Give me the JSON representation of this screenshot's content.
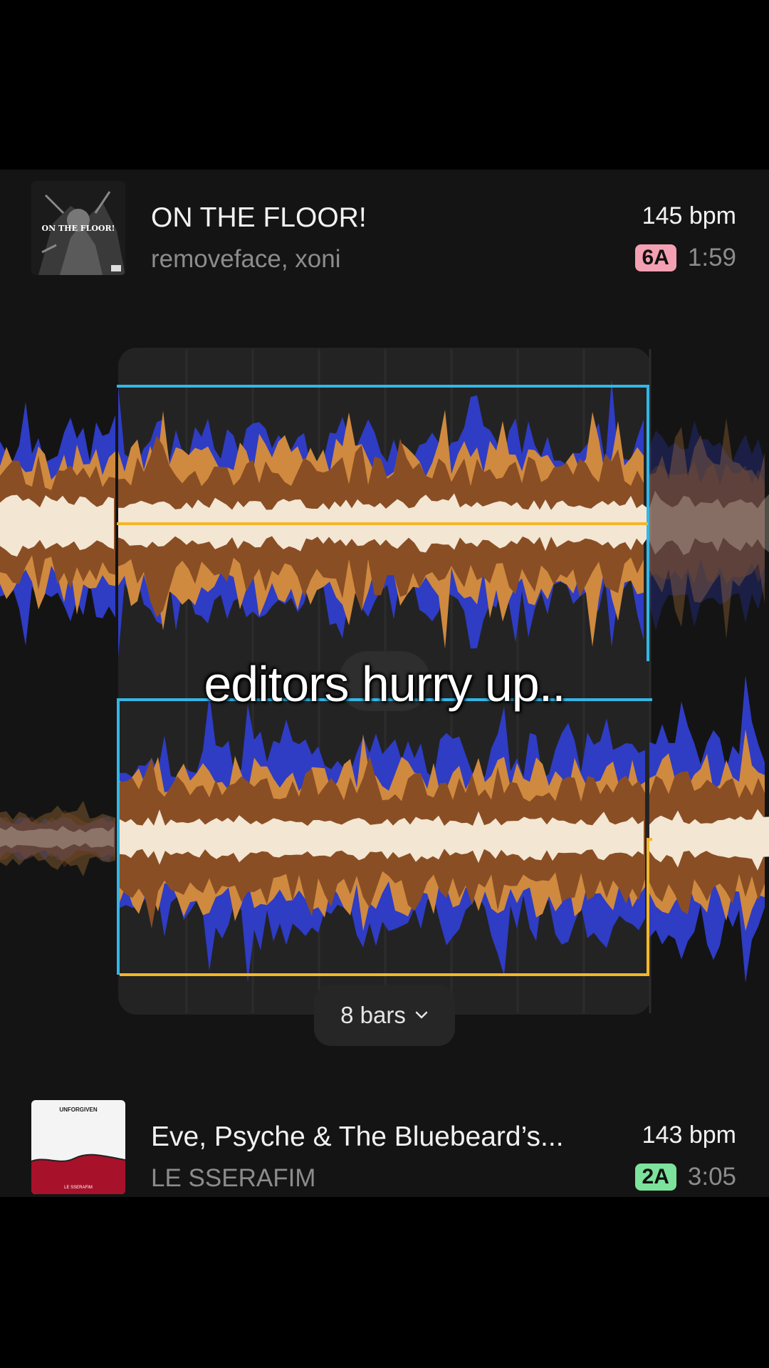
{
  "tracks": {
    "current": {
      "title": "ON THE FLOOR!",
      "artist": "removeface, xoni",
      "bpm": "145 bpm",
      "key": "6A",
      "key_color": "#f4a0b3",
      "duration": "1:59",
      "cover_text": "ON THE FLOOR!"
    },
    "next": {
      "title": "Eve, Psyche & The Bluebeard’s...",
      "artist": "LE SSERAFIM",
      "bpm": "143 bpm",
      "key": "2A",
      "key_color": "#7de39c",
      "duration": "3:05",
      "cover_text": "UNFORGIVEN",
      "cover_subtext": "LE SSERAFIM"
    }
  },
  "transition": {
    "length_label": "8 bars",
    "chevron_icon": "chevron-down-icon"
  },
  "caption": "editors hurry up..",
  "colors": {
    "accent_blue": "#33b7e6",
    "accent_yellow": "#f4b72a",
    "wave_blue": "#2f3cc4",
    "wave_brown": "#8a4e25",
    "wave_orange": "#cf8a3f",
    "wave_cream": "#f3e6d3"
  }
}
